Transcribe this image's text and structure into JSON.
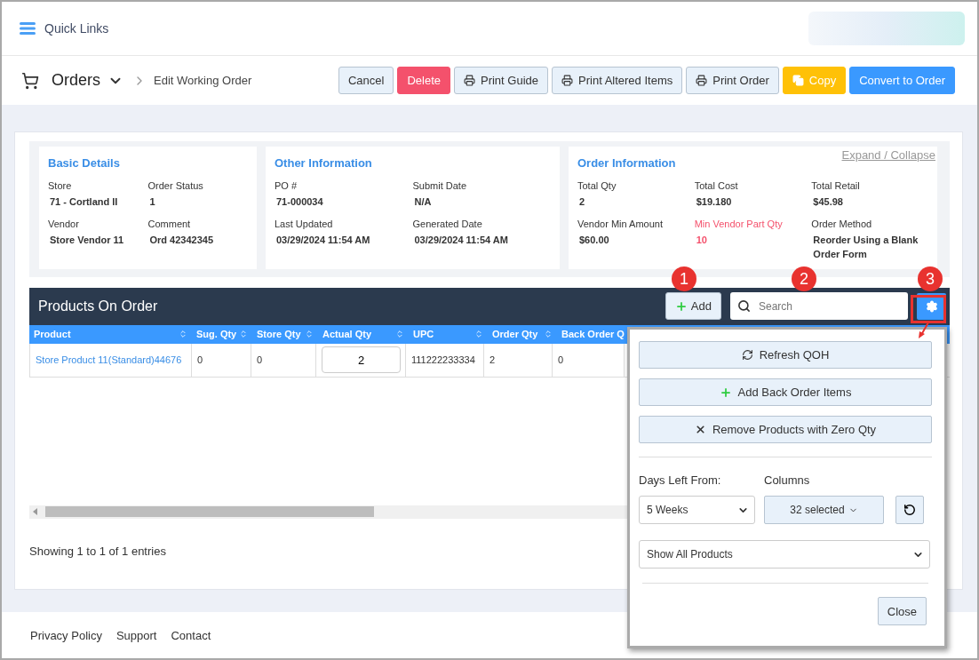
{
  "header": {
    "quick_links": "Quick Links"
  },
  "toolbar": {
    "title": "Orders",
    "breadcrumb": "Edit Working Order",
    "buttons": [
      {
        "label": "Cancel",
        "kind": "default"
      },
      {
        "label": "Delete",
        "kind": "danger"
      },
      {
        "label": "Print Guide",
        "kind": "print"
      },
      {
        "label": "Print Altered Items",
        "kind": "print"
      },
      {
        "label": "Print Order",
        "kind": "print"
      },
      {
        "label": "Copy",
        "kind": "copy"
      },
      {
        "label": "Convert to Order",
        "kind": "primary"
      }
    ]
  },
  "expand_collapse": "Expand / Collapse",
  "info_panels": [
    {
      "title": "Basic Details",
      "fields": [
        {
          "label": "Store",
          "value": "71 - Cortland II",
          "alert": false
        },
        {
          "label": "Order Status",
          "value": "1",
          "alert": false
        },
        {
          "label": "Vendor",
          "value": "Store Vendor 11",
          "alert": false
        },
        {
          "label": "Comment",
          "value": "Ord 42342345",
          "alert": false
        }
      ]
    },
    {
      "title": "Other Information",
      "fields": [
        {
          "label": "PO #",
          "value": "71-000034",
          "alert": false
        },
        {
          "label": "Submit Date",
          "value": "N/A",
          "alert": false
        },
        {
          "label": "Last Updated",
          "value": "03/29/2024 11:54 AM",
          "alert": false
        },
        {
          "label": "Generated Date",
          "value": "03/29/2024 11:54 AM",
          "alert": false
        }
      ]
    },
    {
      "title": "Order Information",
      "fields": [
        {
          "label": "Total Qty",
          "value": "2",
          "alert": false
        },
        {
          "label": "Total Cost",
          "value": "$19.180",
          "alert": false
        },
        {
          "label": "Total Retail",
          "value": "$45.98",
          "alert": false
        },
        {
          "label": "Vendor Min Amount",
          "value": "$60.00",
          "alert": false
        },
        {
          "label": "Min Vendor Part Qty",
          "value": "10",
          "alert": true
        },
        {
          "label": "Order Method",
          "value": "Reorder Using a Blank Order Form",
          "alert": false
        }
      ]
    }
  ],
  "products": {
    "title": "Products On Order",
    "add_button": "Add",
    "search_placeholder": "Search",
    "columns": [
      "Product",
      "Sug. Qty",
      "Store Qty",
      "Actual Qty",
      "UPC",
      "Order Qty",
      "Back Order Q"
    ],
    "rows": [
      {
        "cells": [
          {
            "kind": "link",
            "text": "Store Product 11(Standard)44676"
          },
          {
            "kind": "text",
            "text": "0"
          },
          {
            "kind": "text",
            "text": "0"
          },
          {
            "kind": "input",
            "text": "2"
          },
          {
            "kind": "text",
            "text": "111222233334"
          },
          {
            "kind": "text",
            "text": "2"
          },
          {
            "kind": "text",
            "text": "0"
          }
        ]
      }
    ],
    "entries": "Showing 1 to 1 of 1 entries"
  },
  "settings_popup": {
    "actions": [
      {
        "label": "Refresh QOH",
        "kind": "refresh"
      },
      {
        "label": "Add Back Order Items",
        "kind": "add"
      },
      {
        "label": "Remove Products with Zero Qty",
        "kind": "remove"
      }
    ],
    "days_left_label": "Days Left From:",
    "days_left_value": "5 Weeks",
    "columns_label": "Columns",
    "columns_value": "32 selected",
    "filter_value": "Show All Products",
    "close": "Close"
  },
  "callouts": [
    {
      "label": "1"
    },
    {
      "label": "2"
    },
    {
      "label": "3"
    }
  ],
  "footer": {
    "links": [
      "Privacy Policy",
      "Support",
      "Contact"
    ]
  }
}
